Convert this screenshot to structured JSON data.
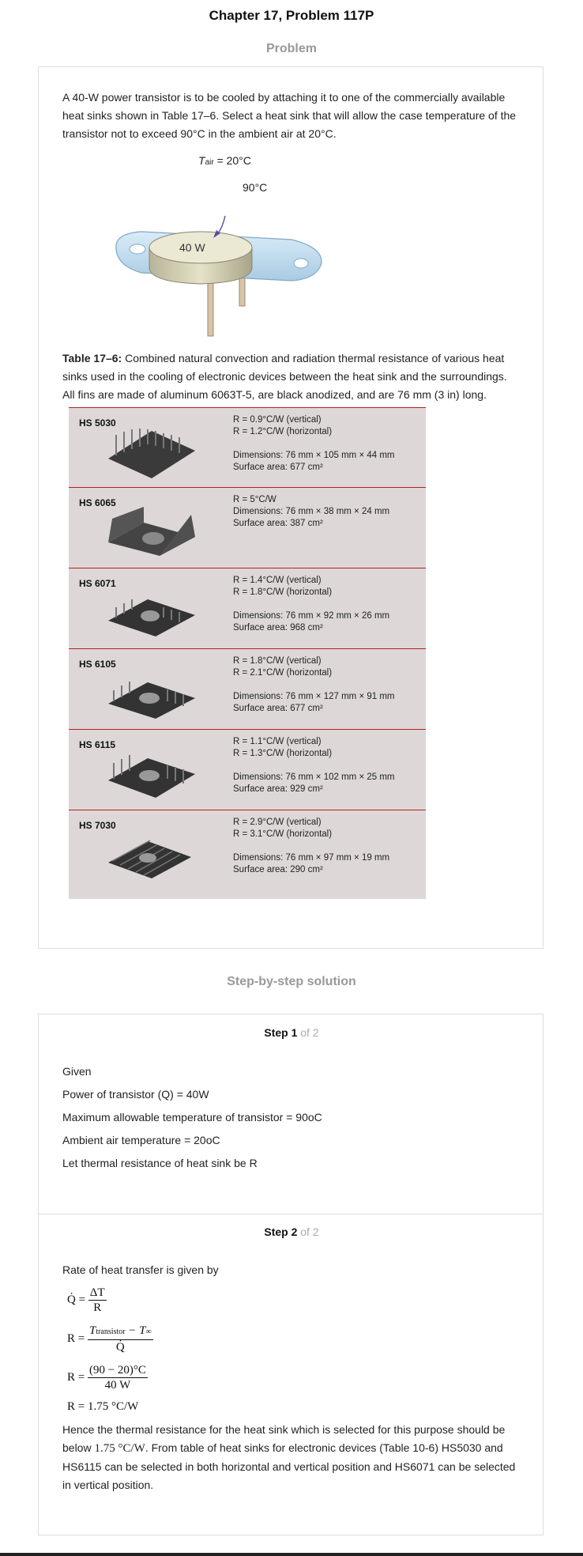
{
  "page_title": "Chapter 17, Problem 117P",
  "problem_label": "Problem",
  "problem_text": "A 40-W power transistor is to be cooled by attaching it to one of the commercially available heat sinks shown in Table 17–6. Select a heat sink that will allow the case temperature of the transistor not to exceed 90°C in the ambient air at 20°C.",
  "figure": {
    "t_air_symbol": "T",
    "t_air_sub": "air",
    "t_air_value": " = 20°C",
    "case_temp": "90°C",
    "power_label": "40 W"
  },
  "table_caption_bold": "Table 17–6:",
  "table_caption": " Combined natural convection and radiation thermal resistance of various heat sinks used in the cooling of electronic devices between the heat sink and the surroundings. All fins are made of aluminum 6063T-5, are black anodized, and are 76 mm (3 in) long.",
  "heat_sinks": [
    {
      "name": "HS 5030",
      "r1": "R = 0.9°C/W (vertical)",
      "r2": "R = 1.2°C/W (horizontal)",
      "dims": "Dimensions: 76 mm × 105 mm × 44 mm",
      "area": "Surface area: 677 cm²"
    },
    {
      "name": "HS 6065",
      "r1": "R = 5°C/W",
      "r2": "",
      "dims": "Dimensions: 76 mm × 38 mm × 24 mm",
      "area": "Surface area: 387 cm²"
    },
    {
      "name": "HS 6071",
      "r1": "R = 1.4°C/W (vertical)",
      "r2": "R = 1.8°C/W (horizontal)",
      "dims": "Dimensions: 76 mm × 92 mm × 26 mm",
      "area": "Surface area: 968 cm²"
    },
    {
      "name": "HS 6105",
      "r1": "R = 1.8°C/W (vertical)",
      "r2": "R = 2.1°C/W (horizontal)",
      "dims": "Dimensions: 76 mm × 127 mm × 91 mm",
      "area": "Surface area: 677 cm²"
    },
    {
      "name": "HS 6115",
      "r1": "R = 1.1°C/W (vertical)",
      "r2": "R = 1.3°C/W (horizontal)",
      "dims": "Dimensions: 76 mm × 102 mm × 25 mm",
      "area": "Surface area: 929 cm²"
    },
    {
      "name": "HS 7030",
      "r1": "R = 2.9°C/W (vertical)",
      "r2": "R = 3.1°C/W (horizontal)",
      "dims": "Dimensions: 76 mm × 97 mm × 19 mm",
      "area": "Surface area: 290 cm²"
    }
  ],
  "solution_label": "Step-by-step solution",
  "step1": {
    "title": "Step 1",
    "of": " of 2",
    "lines": [
      "Given",
      "Power of transistor (Q) = 40W",
      "Maximum allowable temperature of transistor = 90oC",
      "Ambient air temperature = 20oC",
      "Let thermal resistance of heat sink be R"
    ]
  },
  "step2": {
    "title": "Step 2",
    "of": " of 2",
    "intro": "Rate of heat transfer is given by",
    "eq1_lhs": "Q̇ =",
    "eq1_num": "ΔT",
    "eq1_den": "R",
    "eq2_lhs": "R =",
    "eq2_num_a": "T",
    "eq2_num_sub": "transistor",
    "eq2_num_b": " − T",
    "eq2_num_sub2": "∞",
    "eq2_den": "Q̇",
    "eq3_lhs": "R =",
    "eq3_num": "(90 − 20)°C",
    "eq3_den": "40 W",
    "eq4": "R = 1.75 °C/W",
    "conclusion_a": "Hence the thermal resistance for the heat sink which is selected for this purpose should be below ",
    "conclusion_val": "1.75 °C/W",
    "conclusion_b": ". From table of heat sinks for electronic devices (Table 10-6) HS5030 and HS6115 can be selected in both horizontal and vertical position and HS6071 can be selected in vertical position."
  }
}
